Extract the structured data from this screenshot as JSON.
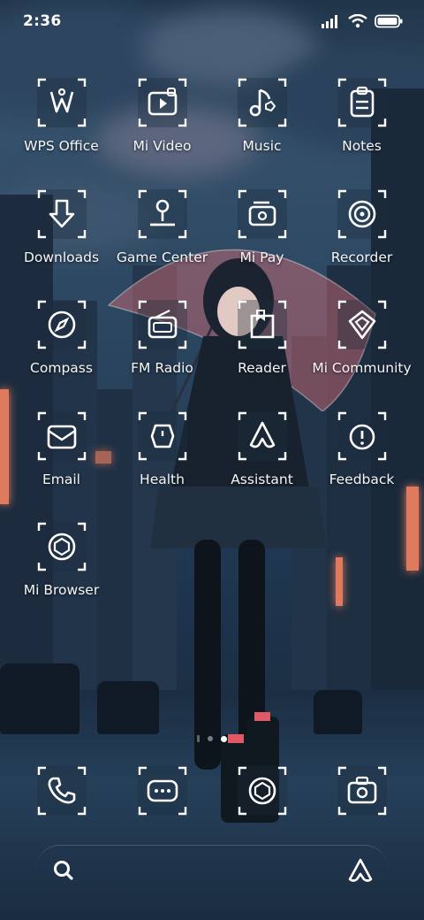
{
  "status_bar": {
    "time": "2:36",
    "icons": [
      "signal-icon",
      "wifi-icon",
      "battery-icon"
    ]
  },
  "home": {
    "apps": [
      {
        "label": "WPS Office",
        "icon": "wps-office-icon"
      },
      {
        "label": "Mi Video",
        "icon": "mi-video-icon"
      },
      {
        "label": "Music",
        "icon": "music-icon"
      },
      {
        "label": "Notes",
        "icon": "notes-icon"
      },
      {
        "label": "Downloads",
        "icon": "downloads-icon"
      },
      {
        "label": "Game Center",
        "icon": "game-center-icon"
      },
      {
        "label": "Mi Pay",
        "icon": "mi-pay-icon"
      },
      {
        "label": "Recorder",
        "icon": "recorder-icon"
      },
      {
        "label": "Compass",
        "icon": "compass-icon"
      },
      {
        "label": "FM Radio",
        "icon": "fm-radio-icon"
      },
      {
        "label": "Reader",
        "icon": "reader-icon"
      },
      {
        "label": "Mi Community",
        "icon": "mi-community-icon"
      },
      {
        "label": "Email",
        "icon": "email-icon"
      },
      {
        "label": "Health",
        "icon": "health-icon"
      },
      {
        "label": "Assistant",
        "icon": "assistant-icon"
      },
      {
        "label": "Feedback",
        "icon": "feedback-icon"
      },
      {
        "label": "Mi Browser",
        "icon": "mi-browser-icon"
      }
    ]
  },
  "pager": {
    "pages": 2,
    "current": 2
  },
  "dock": {
    "apps": [
      {
        "icon": "phone-icon"
      },
      {
        "icon": "messages-icon"
      },
      {
        "icon": "browser-icon"
      },
      {
        "icon": "camera-icon"
      }
    ]
  },
  "bottom_bar": {
    "left": "search-icon",
    "right": "assistant-icon"
  }
}
